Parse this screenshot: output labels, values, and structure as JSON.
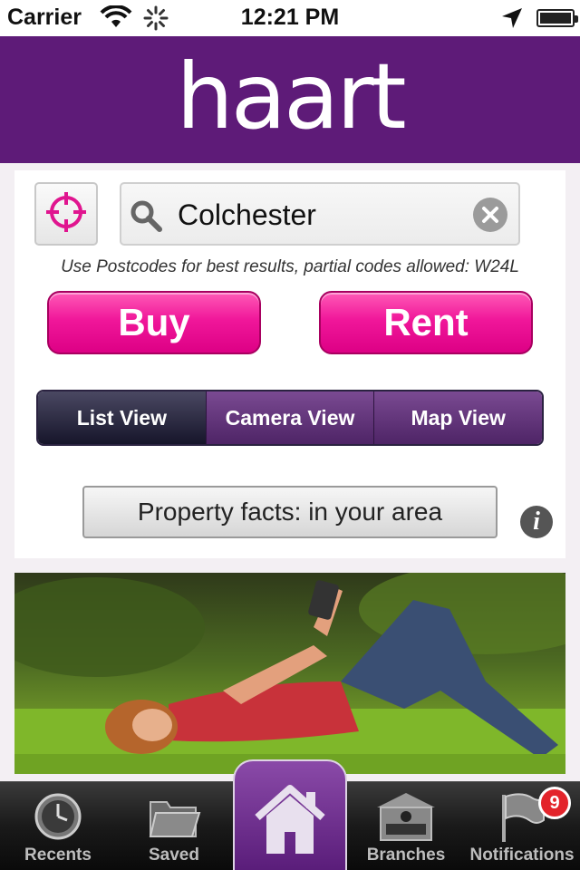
{
  "status_bar": {
    "carrier": "Carrier",
    "time": "12:21 PM"
  },
  "header": {
    "logo_text": "haart",
    "background": "#5e1b78"
  },
  "search": {
    "location_icon": "crosshair-icon",
    "search_icon": "search-icon",
    "value": "Colchester",
    "clear_icon": "clear-icon",
    "hint": "Use Postcodes for best results, partial codes allowed: W24L"
  },
  "actions": {
    "buy_label": "Buy",
    "rent_label": "Rent",
    "accent": "#f0179a"
  },
  "view_modes": {
    "selected": "List View",
    "items": [
      {
        "label": "List View"
      },
      {
        "label": "Camera View"
      },
      {
        "label": "Map View"
      }
    ]
  },
  "facts": {
    "button_label": "Property facts: in your area",
    "info_icon": "info-icon"
  },
  "tabbar": {
    "items": [
      {
        "label": "Recents",
        "icon": "clock-icon"
      },
      {
        "label": "Saved",
        "icon": "folder-icon"
      },
      {
        "label": "",
        "icon": "home-icon"
      },
      {
        "label": "Branches",
        "icon": "branch-desk-icon"
      },
      {
        "label": "Notifications",
        "icon": "flag-icon"
      }
    ],
    "selected": "home",
    "notification_badge": "9"
  }
}
